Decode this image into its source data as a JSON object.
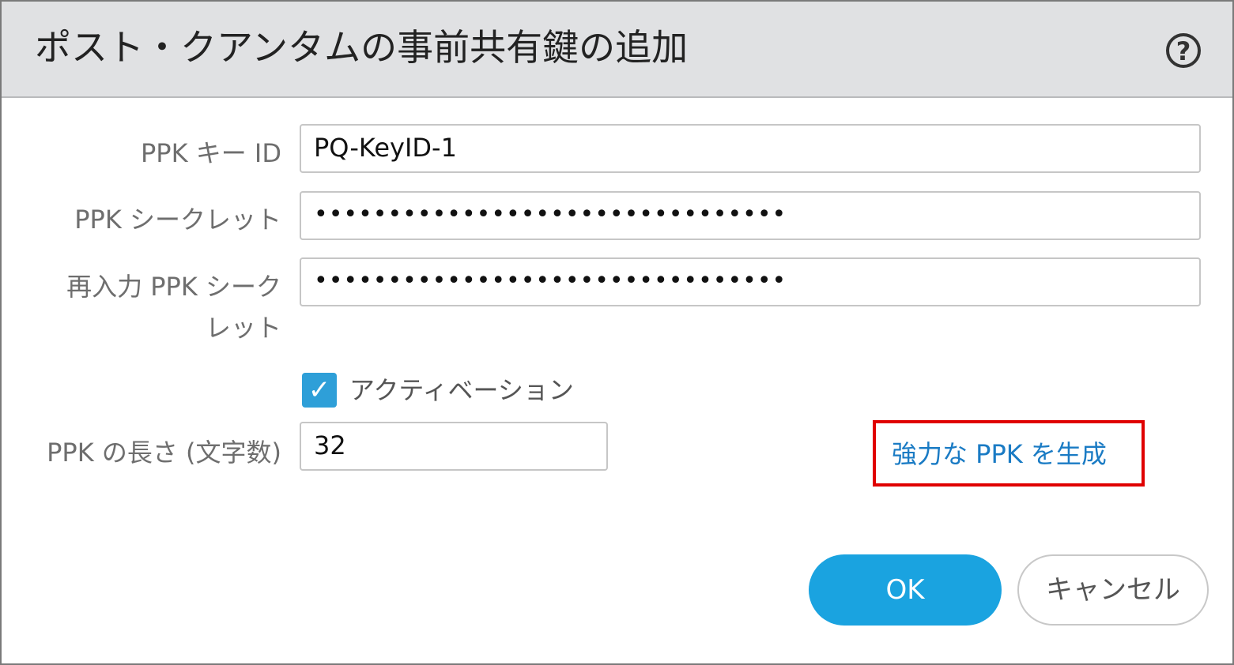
{
  "dialog": {
    "title": "ポスト・クアンタムの事前共有鍵の追加",
    "help_icon_glyph": "?"
  },
  "form": {
    "key_id_label": "PPK キー ID",
    "key_id_value": "PQ-KeyID-1",
    "secret_label": "PPK シークレット",
    "secret_value": "••••••••••••••••••••••••••••••••",
    "reenter_label": "再入力 PPK シークレット",
    "reenter_value": "••••••••••••••••••••••••••••••••",
    "activation_checked": true,
    "activation_label": "アクティベーション",
    "length_label": "PPK の長さ (文字数)",
    "length_value": "32",
    "generate_link": "強力な PPK を生成"
  },
  "buttons": {
    "ok": "OK",
    "cancel": "キャンセル"
  },
  "colors": {
    "header_bg": "#e0e1e3",
    "accent": "#1aa3e0",
    "link": "#1a7bc4",
    "highlight_border": "#e00000",
    "checkbox": "#2e9fd8"
  }
}
